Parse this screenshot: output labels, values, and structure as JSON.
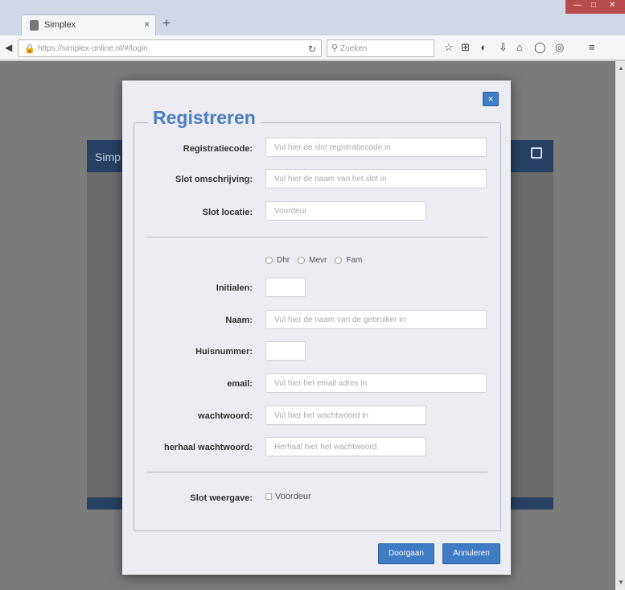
{
  "browser": {
    "tab_title": "Simplex",
    "tab_close": "×",
    "new_tab": "+",
    "url_host": "https://simplex-online.nl",
    "url_path": "/#/login",
    "search_placeholder": "Zoeken",
    "toolbar_icons": [
      "star-icon",
      "reading-icon",
      "pocket-icon",
      "download-icon",
      "home-icon",
      "chat-icon",
      "extension-icon",
      "menu-icon"
    ]
  },
  "page": {
    "header_text": "Simp"
  },
  "modal": {
    "close": "×",
    "title": "Registreren",
    "slot": {
      "code_label": "Registratiecode:",
      "code_placeholder": "Vul hier de slot registratiecode in",
      "desc_label": "Slot omschrijving:",
      "desc_placeholder": "Vul hier de naam van het slot in",
      "loc_label": "Slot locatie:",
      "loc_placeholder": "Voordeur"
    },
    "salutation": [
      "Dhr",
      "Mevr",
      "Fam"
    ],
    "user": {
      "initials_label": "Initialen:",
      "name_label": "Naam:",
      "name_placeholder": "Vul hier de naam van de gebruiker in",
      "house_label": "Huisnummer:",
      "email_label": "email:",
      "email_placeholder": "Vul hier het email adres in",
      "pw_label": "wachtwoord:",
      "pw_placeholder": "Vul hier het wachtwoord in",
      "pw2_label": "herhaal wachtwoord:",
      "pw2_placeholder": "Herhaal hier het wachtwoord"
    },
    "view": {
      "label": "Slot weergave:",
      "option": "Voordeur"
    },
    "buttons": {
      "continue": "Doorgaan",
      "cancel": "Annuleren"
    }
  }
}
